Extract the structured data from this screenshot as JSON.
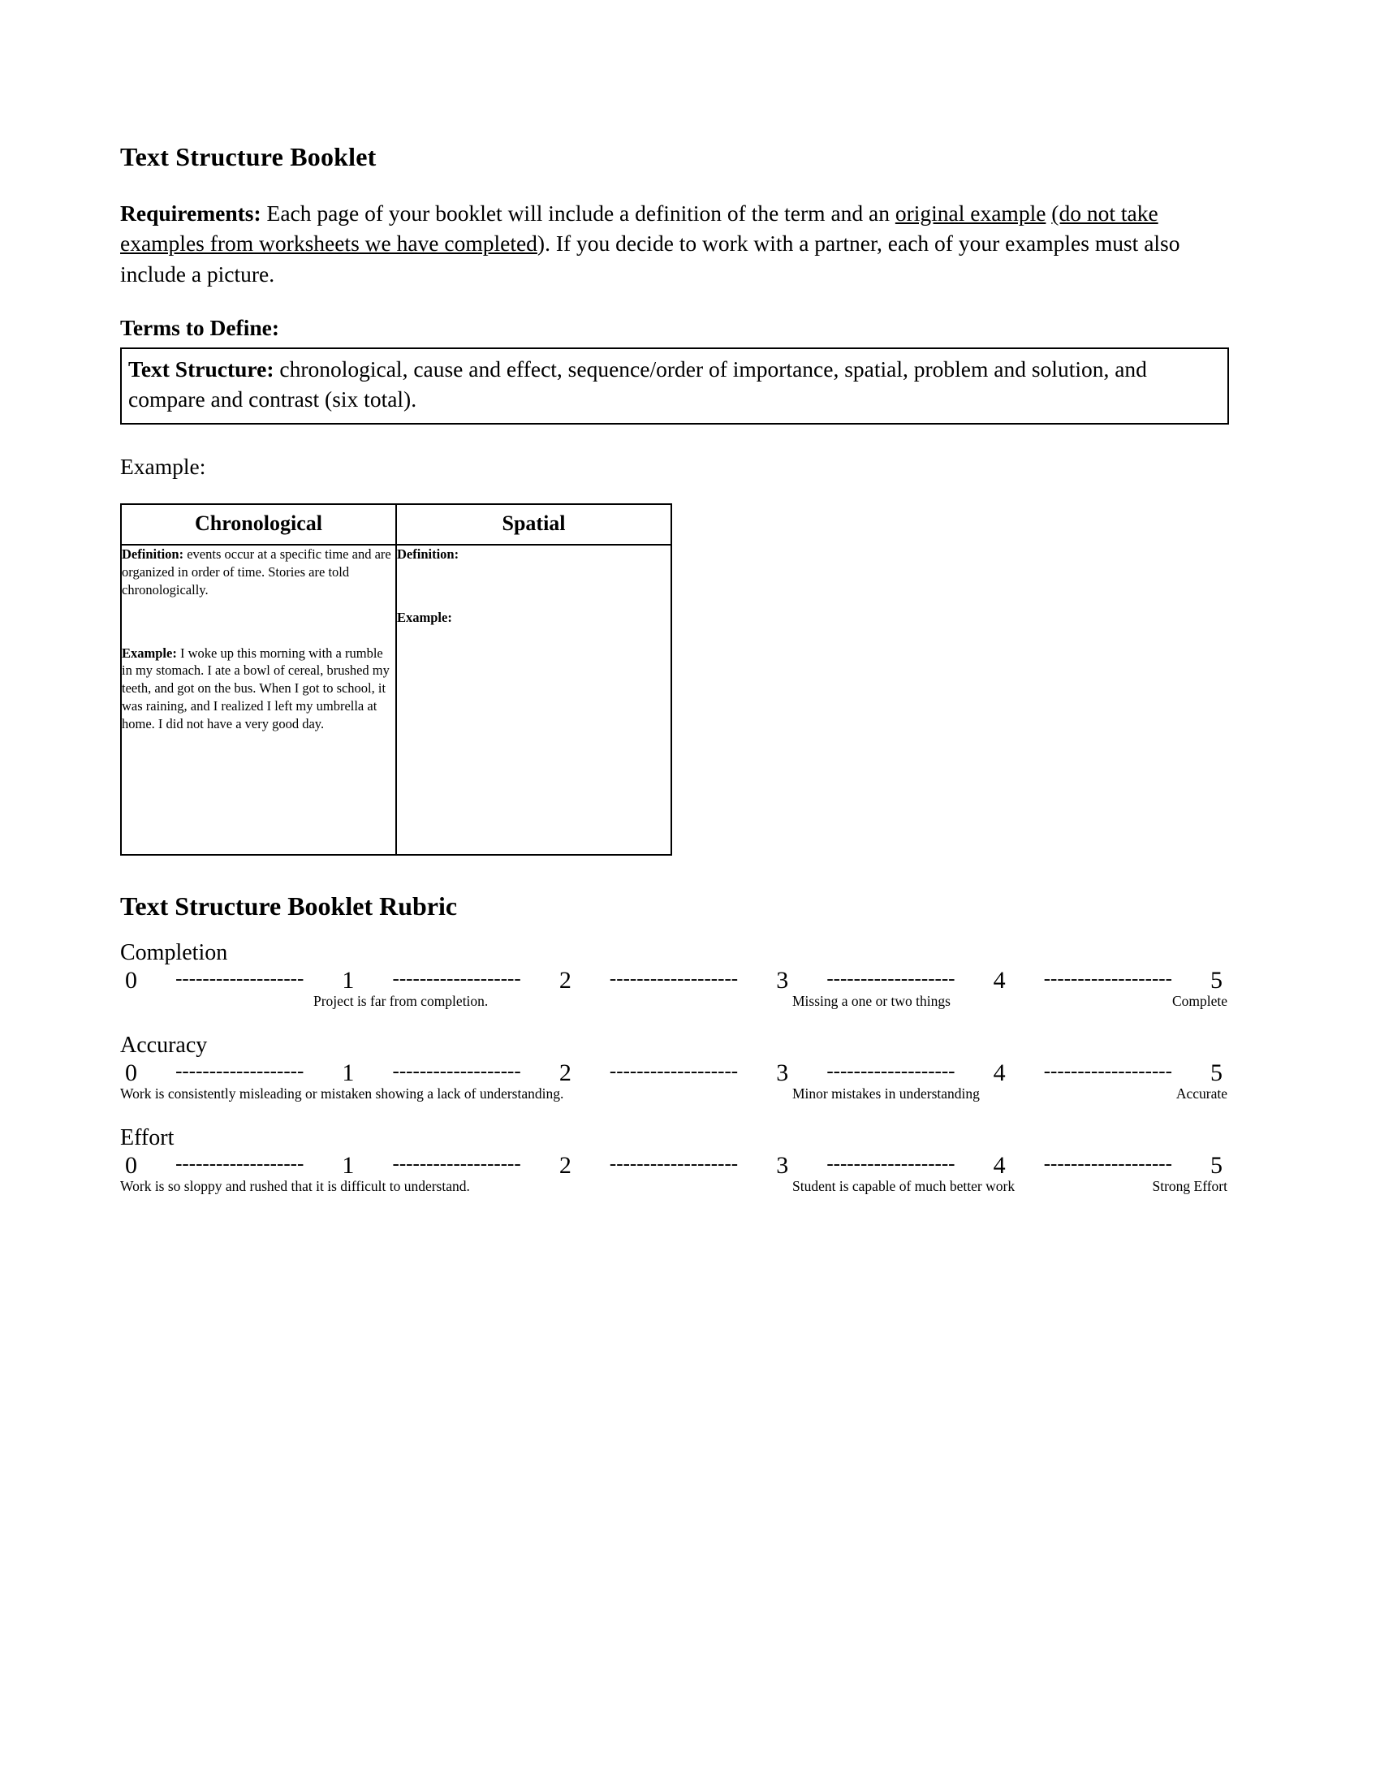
{
  "document": {
    "title": "Text Structure Booklet",
    "requirements": {
      "label": "Requirements:",
      "text_part1": " Each page of your booklet will include a definition of the term and an ",
      "underlined1": "original example",
      "text_part2": " ",
      "underlined2": "(do not take examples from worksheets we have completed",
      "text_part3": ").  If you decide to work with a partner, each of your examples must also include a picture."
    },
    "terms_to_define_label": "Terms to Define:",
    "terms_box": {
      "label": "Text Structure:",
      "text": " chronological, cause and effect, sequence/order of importance, spatial, problem and solution, and compare and contrast (six total)."
    },
    "example_label": "Example:",
    "example_table": {
      "columns": [
        {
          "header": "Chronological",
          "definition_label": "Definition:",
          "definition_text": " events occur at a specific time and are organized in order of time.  Stories are told chronologically.",
          "example_label": "Example:",
          "example_text": "  I woke up this morning with a rumble in my stomach.  I ate a bowl of cereal, brushed my teeth, and got on the bus.  When I got to school, it was  raining, and I realized I left my umbrella at home.  I did not have a very good day."
        },
        {
          "header": "Spatial",
          "definition_label": "Definition:",
          "definition_text": "",
          "example_label": "Example:",
          "example_text": ""
        }
      ]
    },
    "rubric": {
      "title": "Text Structure Booklet Rubric",
      "scale_numbers": [
        "0",
        "1",
        "2",
        "3",
        "4",
        "5"
      ],
      "dash_run": "-------------------",
      "rows": [
        {
          "category": "Completion",
          "caption_low": "Project is far from completion.",
          "caption_mid": "Missing a one or two things",
          "caption_high": "Complete",
          "low_align": "indent"
        },
        {
          "category": "Accuracy",
          "caption_low": "Work is consistently misleading or mistaken showing a lack of understanding.",
          "caption_mid": "Minor mistakes in understanding",
          "caption_high": "Accurate",
          "low_align": "left"
        },
        {
          "category": "Effort",
          "caption_low": "Work is so sloppy and rushed that it is difficult to understand.",
          "caption_mid": "Student is capable of much better work",
          "caption_high": "Strong Effort",
          "low_align": "left"
        }
      ]
    }
  }
}
